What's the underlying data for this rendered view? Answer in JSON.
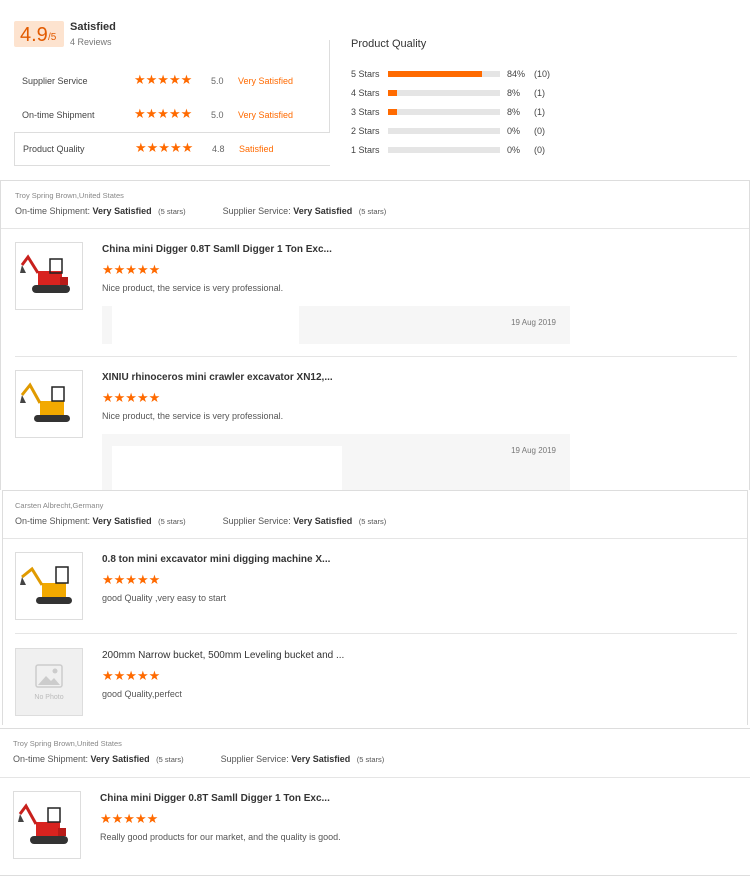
{
  "summary": {
    "score": "4.9",
    "score_suffix": "/5",
    "rating_word": "Satisfied",
    "review_count": "4 Reviews",
    "categories": [
      {
        "label": "Supplier Service",
        "stars": "★★★★★",
        "value": "5.0",
        "word": "Very Satisfied"
      },
      {
        "label": "On-time Shipment",
        "stars": "★★★★★",
        "value": "5.0",
        "word": "Very Satisfied"
      },
      {
        "label": "Product Quality",
        "stars": "★★★★★",
        "value": "4.8",
        "word": "Satisfied"
      }
    ],
    "product_quality_title": "Product Quality",
    "distribution": [
      {
        "label": "5 Stars",
        "fraction": 0.84,
        "pct": "84%",
        "count": "(10)"
      },
      {
        "label": "4 Stars",
        "fraction": 0.08,
        "pct": "8%",
        "count": "(1)"
      },
      {
        "label": "3 Stars",
        "fraction": 0.08,
        "pct": "8%",
        "count": "(1)"
      },
      {
        "label": "2 Stars",
        "fraction": 0.0,
        "pct": "0%",
        "count": "(0)"
      },
      {
        "label": "1 Stars",
        "fraction": 0.0,
        "pct": "0%",
        "count": "(0)"
      }
    ]
  },
  "labels": {
    "ontime": "On-time Shipment:",
    "supplier": "Supplier Service:",
    "no_photo": "No Photo"
  },
  "colors": {
    "accent": "#ff6a00",
    "score_bg": "#fde3cf",
    "bar_bg": "#e5e5e5"
  },
  "reviews": [
    {
      "reviewer": "Troy Spring Brown,United States",
      "ontime_value": "Very Satisfied",
      "ontime_stars": "(5 stars)",
      "supplier_value": "Very Satisfied",
      "supplier_stars": "(5 stars)",
      "items": [
        {
          "title": "China mini Digger 0.8T Samll Digger 1 Ton Exc...",
          "stars": "★★★★★",
          "comment": "Nice product, the service is very professional.",
          "reply_date": "19 Aug 2019",
          "image": "red-excavator"
        },
        {
          "title": "XINIU rhinoceros mini crawler excavator XN12,...",
          "stars": "★★★★★",
          "comment": "Nice product, the service is very professional.",
          "reply_date": "19 Aug 2019",
          "image": "yellow-excavator"
        }
      ]
    },
    {
      "reviewer": "Carsten Albrecht,Germany",
      "ontime_value": "Very Satisfied",
      "ontime_stars": "(5 stars)",
      "supplier_value": "Very Satisfied",
      "supplier_stars": "(5 stars)",
      "items": [
        {
          "title": "0.8 ton mini excavator mini digging machine X...",
          "stars": "★★★★★",
          "comment": "good Quality ,very easy to start",
          "image": "yellow-excavator"
        },
        {
          "title": "200mm Narrow bucket, 500mm Leveling bucket and ...",
          "stars": "★★★★★",
          "comment": "good Quality,perfect",
          "image": "no-photo"
        }
      ]
    },
    {
      "reviewer": "Troy Spring Brown,United States",
      "ontime_value": "Very Satisfied",
      "ontime_stars": "(5 stars)",
      "supplier_value": "Very Satisfied",
      "supplier_stars": "(5 stars)",
      "items": [
        {
          "title": "China mini Digger 0.8T Samll Digger 1 Ton Exc...",
          "stars": "★★★★★",
          "comment": "Really good products for our market, and the quality is good.",
          "image": "red-excavator"
        }
      ]
    }
  ]
}
